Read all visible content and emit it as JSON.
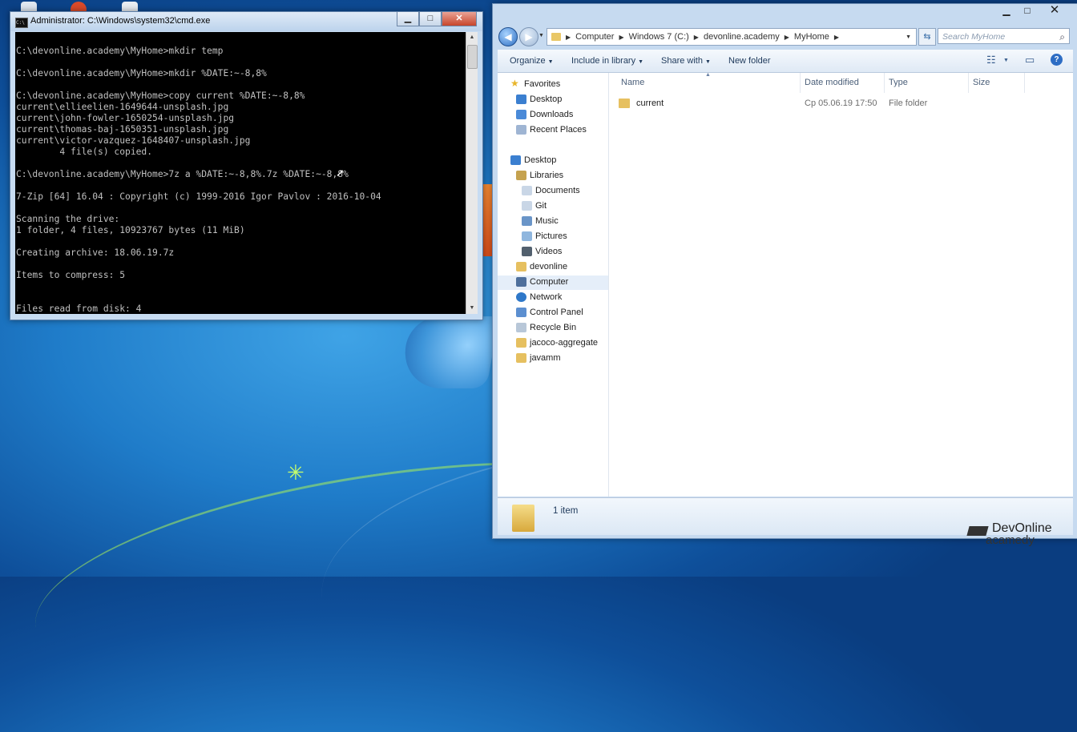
{
  "cmd": {
    "title": "Administrator: C:\\Windows\\system32\\cmd.exe",
    "icon_text": "C:\\",
    "lines": [
      "C:\\devonline.academy\\MyHome>mkdir temp",
      "",
      "C:\\devonline.academy\\MyHome>mkdir %DATE:~-8,8%",
      "",
      "C:\\devonline.academy\\MyHome>copy current %DATE:~-8,8%",
      "current\\ellieelien-1649644-unsplash.jpg",
      "current\\john-fowler-1650254-unsplash.jpg",
      "current\\thomas-baj-1650351-unsplash.jpg",
      "current\\victor-vazquez-1648407-unsplash.jpg",
      "        4 file(s) copied.",
      "",
      "C:\\devonline.academy\\MyHome>7z a %DATE:~-8,8%.7z %DATE:~-8,8%",
      "",
      "7-Zip [64] 16.04 : Copyright (c) 1999-2016 Igor Pavlov : 2016-10-04",
      "",
      "Scanning the drive:",
      "1 folder, 4 files, 10923767 bytes (11 MiB)",
      "",
      "Creating archive: 18.06.19.7z",
      "",
      "Items to compress: 5",
      "",
      "",
      "Files read from disk: 4"
    ]
  },
  "window_buttons": {
    "minimize": "▁",
    "maximize": "□",
    "close": "✕"
  },
  "explorer": {
    "breadcrumb": [
      "Computer",
      "Windows 7 (C:)",
      "devonline.academy",
      "MyHome"
    ],
    "search_placeholder": "Search MyHome",
    "toolbar": {
      "organize": "Organize",
      "include_in_library": "Include in library",
      "share_with": "Share with",
      "new_folder": "New folder"
    },
    "nav": {
      "favorites": "Favorites",
      "fav_desktop": "Desktop",
      "downloads": "Downloads",
      "recent_places": "Recent Places",
      "desktop": "Desktop",
      "libraries": "Libraries",
      "documents": "Documents",
      "git": "Git",
      "music": "Music",
      "pictures": "Pictures",
      "videos": "Videos",
      "devonline": "devonline",
      "computer": "Computer",
      "network": "Network",
      "control_panel": "Control Panel",
      "recycle_bin": "Recycle Bin",
      "jacoco": "jacoco-aggregate",
      "javamm": "javamm"
    },
    "columns": {
      "name": "Name",
      "date_modified": "Date modified",
      "type": "Type",
      "size": "Size"
    },
    "files": [
      {
        "name": "current",
        "date_modified": "Ср 05.06.19 17:50",
        "type": "File folder",
        "size": ""
      }
    ],
    "status": "1 item"
  },
  "watermark": {
    "line1": "DevOnline",
    "line2": "acamedy"
  },
  "colors": {
    "desktop": "#1f7cc9",
    "cmd_bg": "#000000",
    "cmd_text": "#c0c0c0",
    "selection": "#e5eef9"
  }
}
